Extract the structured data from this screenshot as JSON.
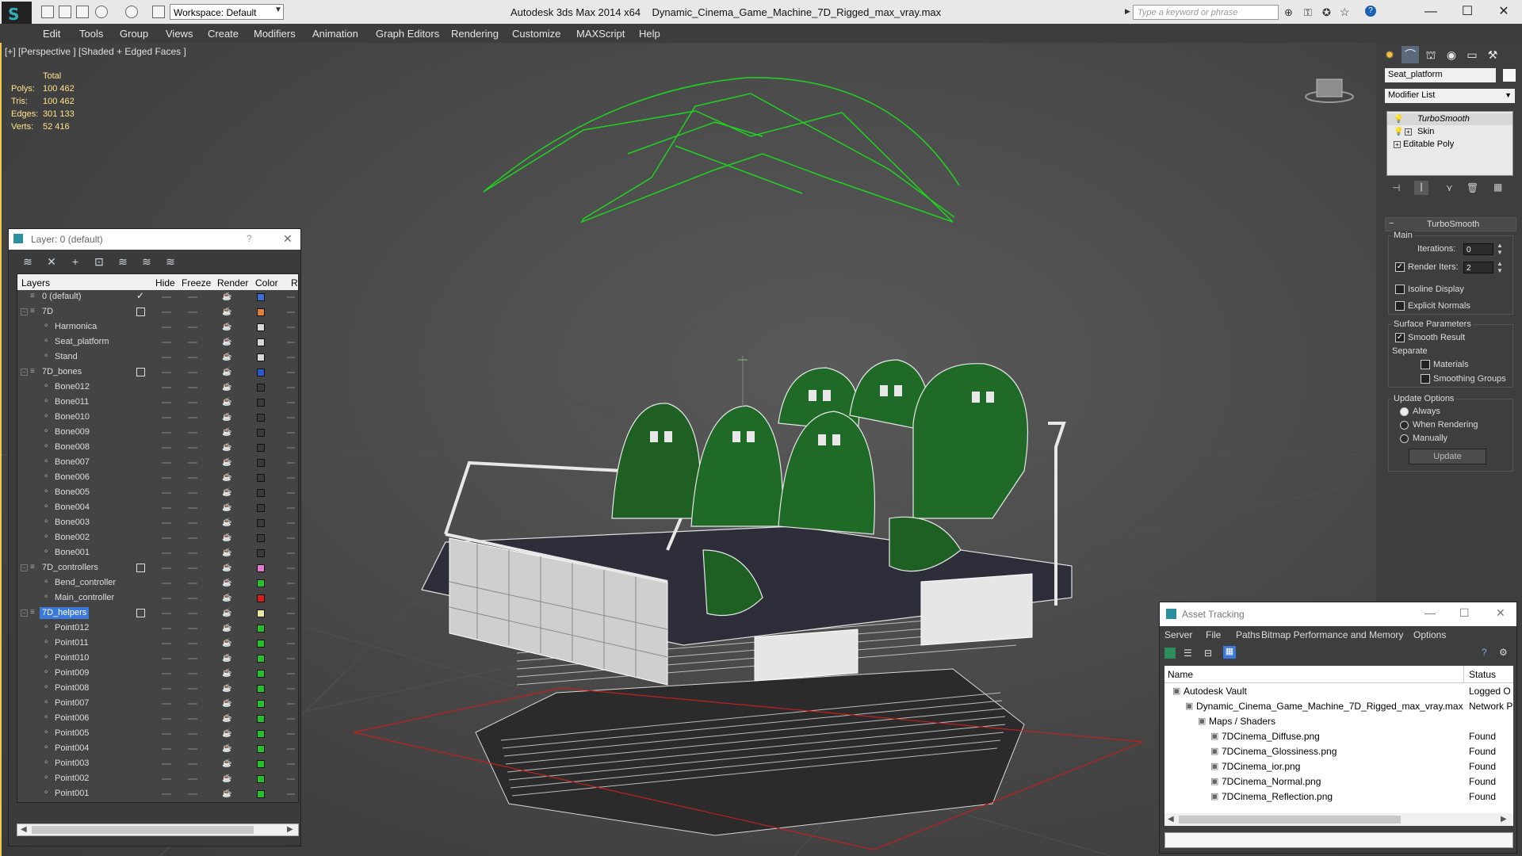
{
  "titlebar": {
    "workspace_value": "Workspace: Default",
    "app_title": "Autodesk 3ds Max  2014 x64",
    "file_title": "Dynamic_Cinema_Game_Machine_7D_Rigged_max_vray.max",
    "search_placeholder": "Type a keyword or phrase",
    "minimize": "—",
    "maximize": "☐",
    "close": "✕"
  },
  "menu": [
    "Edit",
    "Tools",
    "Group",
    "Views",
    "Create",
    "Modifiers",
    "Animation",
    "Graph Editors",
    "Rendering",
    "Customize",
    "MAXScript",
    "Help"
  ],
  "viewport": {
    "label": "[+] [Perspective ] [Shaded + Edged Faces ]",
    "stats": {
      "header": "Total",
      "rows": [
        {
          "label": "Polys:",
          "value": "100 462"
        },
        {
          "label": "Tris:",
          "value": "100 462"
        },
        {
          "label": "Edges:",
          "value": "301 133"
        },
        {
          "label": "Verts:",
          "value": "52 416"
        }
      ]
    }
  },
  "layer_panel": {
    "title": "Layer: 0 (default)",
    "help": "?",
    "close": "✕",
    "columns": {
      "layers": "Layers",
      "hide": "Hide",
      "freeze": "Freeze",
      "render": "Render",
      "color": "Color",
      "radiosity": "Ra"
    },
    "rows": [
      {
        "name": "0 (default)",
        "level": 0,
        "active": true,
        "color": "#3b6fd8",
        "expand": ""
      },
      {
        "name": "7D",
        "level": 0,
        "active": false,
        "color": "#e0813a",
        "expand": "−",
        "box": true
      },
      {
        "name": "Harmonica",
        "level": 1,
        "color": "#d8d8d8"
      },
      {
        "name": "Seat_platform",
        "level": 1,
        "color": "#d8d8d8"
      },
      {
        "name": "Stand",
        "level": 1,
        "color": "#d8d8d8"
      },
      {
        "name": "7D_bones",
        "level": 0,
        "color": "#2b59d0",
        "expand": "−",
        "box": true
      },
      {
        "name": "Bone012",
        "level": 1,
        "color": "#3a3a3a"
      },
      {
        "name": "Bone011",
        "level": 1,
        "color": "#3a3a3a"
      },
      {
        "name": "Bone010",
        "level": 1,
        "color": "#3a3a3a"
      },
      {
        "name": "Bone009",
        "level": 1,
        "color": "#3a3a3a"
      },
      {
        "name": "Bone008",
        "level": 1,
        "color": "#3a3a3a"
      },
      {
        "name": "Bone007",
        "level": 1,
        "color": "#3a3a3a"
      },
      {
        "name": "Bone006",
        "level": 1,
        "color": "#3a3a3a"
      },
      {
        "name": "Bone005",
        "level": 1,
        "color": "#3a3a3a"
      },
      {
        "name": "Bone004",
        "level": 1,
        "color": "#3a3a3a"
      },
      {
        "name": "Bone003",
        "level": 1,
        "color": "#3a3a3a"
      },
      {
        "name": "Bone002",
        "level": 1,
        "color": "#3a3a3a"
      },
      {
        "name": "Bone001",
        "level": 1,
        "color": "#3a3a3a"
      },
      {
        "name": "7D_controllers",
        "level": 0,
        "color": "#e07ad0",
        "expand": "−",
        "box": true
      },
      {
        "name": "Bend_controller",
        "level": 1,
        "color": "#22c22a"
      },
      {
        "name": "Main_controller",
        "level": 1,
        "color": "#d81e1e"
      },
      {
        "name": "7D_helpers",
        "level": 0,
        "color": "#e8e8a0",
        "expand": "−",
        "box": true,
        "selected": true
      },
      {
        "name": "Point012",
        "level": 1,
        "color": "#22c22a"
      },
      {
        "name": "Point011",
        "level": 1,
        "color": "#22c22a"
      },
      {
        "name": "Point010",
        "level": 1,
        "color": "#22c22a"
      },
      {
        "name": "Point009",
        "level": 1,
        "color": "#22c22a"
      },
      {
        "name": "Point008",
        "level": 1,
        "color": "#22c22a"
      },
      {
        "name": "Point007",
        "level": 1,
        "color": "#22c22a"
      },
      {
        "name": "Point006",
        "level": 1,
        "color": "#22c22a"
      },
      {
        "name": "Point005",
        "level": 1,
        "color": "#22c22a"
      },
      {
        "name": "Point004",
        "level": 1,
        "color": "#22c22a"
      },
      {
        "name": "Point003",
        "level": 1,
        "color": "#22c22a"
      },
      {
        "name": "Point002",
        "level": 1,
        "color": "#22c22a"
      },
      {
        "name": "Point001",
        "level": 1,
        "color": "#22c22a"
      }
    ]
  },
  "command_panel": {
    "object_name": "Seat_platform",
    "modifier_list": "Modifier List",
    "stack": [
      "TurboSmooth",
      "Skin",
      "Editable Poly"
    ],
    "rollout_title": "TurboSmooth",
    "main_label": "Main",
    "iterations_label": "Iterations:",
    "iterations_value": "0",
    "render_iters_label": "Render Iters:",
    "render_iters_value": "2",
    "isoline": "Isoline Display",
    "explicit": "Explicit Normals",
    "surface_params": "Surface Parameters",
    "smooth_result": "Smooth Result",
    "separate": "Separate",
    "materials": "Materials",
    "smoothing_groups": "Smoothing Groups",
    "update_options": "Update Options",
    "always": "Always",
    "when_rendering": "When Rendering",
    "manually": "Manually",
    "update_button": "Update"
  },
  "asset_tracking": {
    "title": "Asset Tracking",
    "menu": [
      "Server",
      "File",
      "Paths",
      "Bitmap Performance and Memory",
      "Options"
    ],
    "col_name": "Name",
    "col_status": "Status",
    "rows": [
      {
        "name": "Autodesk Vault",
        "indent": 1,
        "status": "Logged O"
      },
      {
        "name": "Dynamic_Cinema_Game_Machine_7D_Rigged_max_vray.max",
        "indent": 2,
        "status": "Network P"
      },
      {
        "name": "Maps / Shaders",
        "indent": 3,
        "status": ""
      },
      {
        "name": "7DCinema_Diffuse.png",
        "indent": 4,
        "status": "Found"
      },
      {
        "name": "7DCinema_Glossiness.png",
        "indent": 4,
        "status": "Found"
      },
      {
        "name": "7DCinema_ior.png",
        "indent": 4,
        "status": "Found"
      },
      {
        "name": "7DCinema_Normal.png",
        "indent": 4,
        "status": "Found"
      },
      {
        "name": "7DCinema_Reflection.png",
        "indent": 4,
        "status": "Found"
      }
    ]
  },
  "colors": {
    "accent": "#f2c84b",
    "selection": "#3b78d8",
    "wire_green": "#22c22a"
  }
}
